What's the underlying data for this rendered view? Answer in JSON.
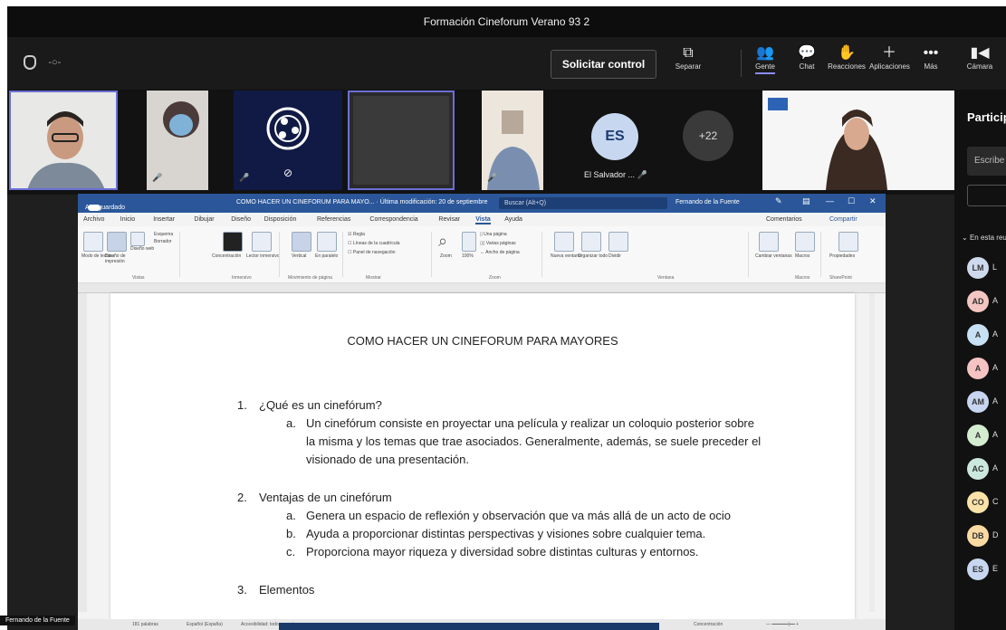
{
  "window": {
    "title": "Formación Cineforum Verano 93 2"
  },
  "toolbar": {
    "request_control": "Solicitar control",
    "items": [
      {
        "label": "Separar",
        "icon": "popout-icon"
      },
      {
        "label": "Gente",
        "icon": "people-icon"
      },
      {
        "label": "Chat",
        "icon": "chat-icon"
      },
      {
        "label": "Reacciones",
        "icon": "reactions-icon"
      },
      {
        "label": "Aplicaciones",
        "icon": "plus-icon"
      },
      {
        "label": "Más",
        "icon": "more-icon"
      },
      {
        "label": "Cámara",
        "icon": "camera-icon"
      }
    ]
  },
  "participants_strip": {
    "es_initials": "ES",
    "es_name": "El Salvador ...",
    "more_count": "+22"
  },
  "panel": {
    "title": "Participantes",
    "search_placeholder": "Escribe",
    "group": "En esta reunión",
    "people": [
      {
        "initials": "LM",
        "letter": "L",
        "color": "#cfd9ee"
      },
      {
        "initials": "AD",
        "letter": "A",
        "color": "#f4c6c1"
      },
      {
        "initials": "A",
        "letter": "A",
        "color": "#c7e0f4"
      },
      {
        "initials": "A",
        "letter": "A",
        "color": "#f6c3c3"
      },
      {
        "initials": "AM",
        "letter": "A",
        "color": "#c7d5f0"
      },
      {
        "initials": "A",
        "letter": "A",
        "color": "#d4ecd0"
      },
      {
        "initials": "AC",
        "letter": "A",
        "color": "#cbe8df"
      },
      {
        "initials": "CO",
        "letter": "C",
        "color": "#fbe3a8"
      },
      {
        "initials": "DB",
        "letter": "D",
        "color": "#fbd9a3"
      },
      {
        "initials": "ES",
        "letter": "E",
        "color": "#c7d7f0"
      }
    ]
  },
  "word": {
    "autosave": "Autoguardado",
    "doc_title": "COMO HACER UN CINEFORUM PARA MAYO... · Última modificación: 20 de septiembre",
    "search": "Buscar (Alt+Q)",
    "user": "Fernando de la Fuente",
    "tabs": [
      "Archivo",
      "Inicio",
      "Insertar",
      "Dibujar",
      "Diseño",
      "Disposición",
      "Referencias",
      "Correspondencia",
      "Revisar",
      "Vista",
      "Ayuda"
    ],
    "active_tab": "Vista",
    "comments": "Comentarios",
    "share": "Compartir",
    "ribbon_groups": [
      "Vistas",
      "Inmersivo",
      "Movimiento de página",
      "Mostrar",
      "Zoom",
      "Ventana",
      "Macros",
      "SharePoint"
    ],
    "ribbon_labels": {
      "modo_lectura": "Modo de lectura",
      "diseno_impresion": "Diseño de impresión",
      "diseno_web": "Diseño web",
      "esquema": "Esquema",
      "borrador": "Borrador",
      "concentracion": "Concentración",
      "lector": "Lector inmersivo",
      "vertical": "Vertical",
      "paralelo": "En paralelo",
      "regla": "Regla",
      "cuadricula": "Líneas de la cuadrícula",
      "navegacion": "Panel de navegación",
      "zoom": "Zoom",
      "cien": "100%",
      "una_pagina": "Una página",
      "varias_paginas": "Varias páginas",
      "ancho_pagina": "Ancho de página",
      "nueva_ventana": "Nueva ventana",
      "organizar": "Organizar todo",
      "dividir": "Dividir",
      "cambiar": "Cambiar ventanas",
      "macros": "Macros",
      "propiedades": "Propiedades"
    },
    "status": {
      "words": "181 palabras",
      "language": "Español (España)",
      "accessibility": "Accesibilidad: todo correcto",
      "focus": "Concentración"
    }
  },
  "document": {
    "title": "COMO HACER UN CINEFORUM PARA MAYORES",
    "sections": [
      {
        "num": "1.",
        "heading": "¿Qué es un cinefórum?",
        "items": [
          {
            "letter": "a.",
            "text": "Un cinefórum consiste en proyectar una película y realizar un coloquio posterior sobre la misma y los temas que trae asociados. Generalmente, además, se suele preceder el visionado de una presentación."
          }
        ]
      },
      {
        "num": "2.",
        "heading": "Ventajas de un cinefórum",
        "items": [
          {
            "letter": "a.",
            "text": "Genera un espacio de reflexión y observación que va más allá de un acto de ocio"
          },
          {
            "letter": "b.",
            "text": "Ayuda a proporcionar distintas perspectivas y visiones sobre cualquier tema."
          },
          {
            "letter": "c.",
            "text": "Proporciona mayor riqueza y diversidad sobre distintas culturas y entornos."
          }
        ]
      },
      {
        "num": "3.",
        "heading": "Elementos",
        "items": []
      }
    ]
  },
  "presenter_name": "Fernando de la Fuente"
}
